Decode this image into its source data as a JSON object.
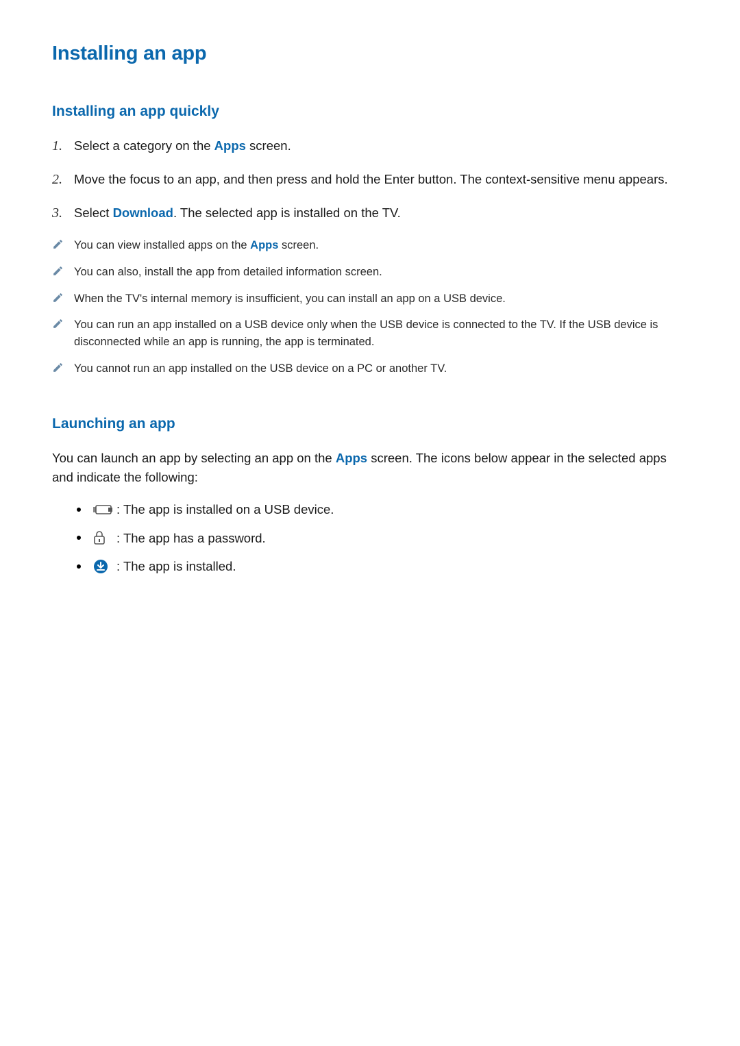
{
  "heading": "Installing an app",
  "section1": {
    "title": "Installing an app quickly",
    "steps": [
      {
        "num": "1.",
        "pre": "Select a category on the ",
        "link": "Apps",
        "post": " screen."
      },
      {
        "num": "2.",
        "pre": "Move the focus to an app, and then press and hold the Enter button. The context-sensitive menu appears.",
        "link": "",
        "post": ""
      },
      {
        "num": "3.",
        "pre": "Select ",
        "link": "Download",
        "post": ". The selected app is installed on the TV."
      }
    ],
    "notes": [
      {
        "pre": "You can view installed apps on the ",
        "link": "Apps",
        "post": " screen."
      },
      {
        "pre": "You can also, install the app from detailed information screen.",
        "link": "",
        "post": ""
      },
      {
        "pre": "When the TV's internal memory is insufficient, you can install an app on a USB device.",
        "link": "",
        "post": ""
      },
      {
        "pre": "You can run an app installed on a USB device only when the USB device is connected to the TV. If the USB device is disconnected while an app is running, the app is terminated.",
        "link": "",
        "post": ""
      },
      {
        "pre": "You cannot run an app installed on the USB device on a PC or another TV.",
        "link": "",
        "post": ""
      }
    ]
  },
  "section2": {
    "title": "Launching an app",
    "intro_pre": "You can launch an app by selecting an app on the ",
    "intro_link": "Apps",
    "intro_post": " screen. The icons below appear in the selected apps and indicate the following:",
    "icons": [
      {
        "label": " : The app is installed on a USB device."
      },
      {
        "label": " : The app has a password."
      },
      {
        "label": " : The app is installed."
      }
    ]
  }
}
